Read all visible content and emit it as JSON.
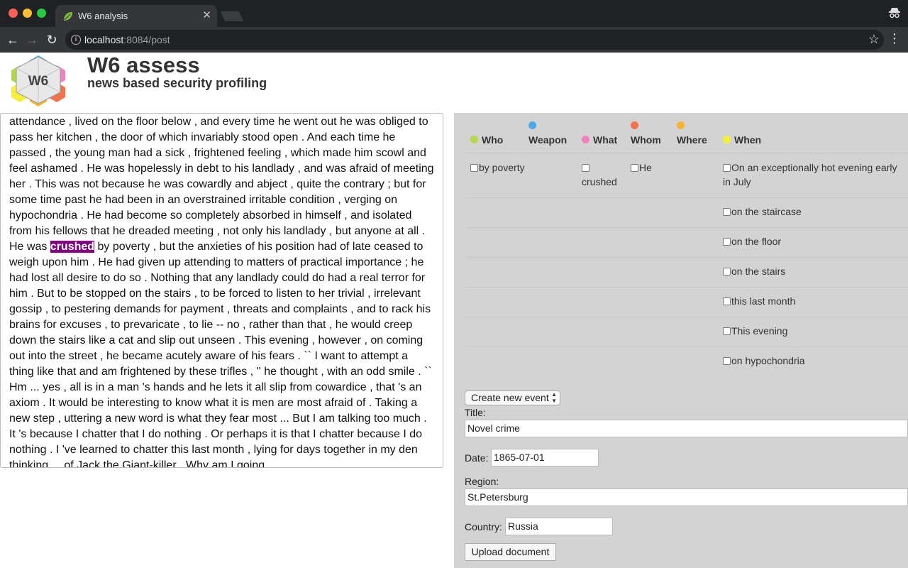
{
  "browser": {
    "tab_title": "W6 analysis",
    "tab_close": "✕",
    "url_host": "localhost",
    "url_rest": ":8084/post"
  },
  "header": {
    "logo_text": "W6",
    "title": "W6 assess",
    "subtitle": "news based security profiling"
  },
  "text_panel": {
    "before": "attendance , lived on the floor below , and every time he went out he was obliged to pass her kitchen , the door of which invariably stood open . And each time he passed , the young man had a sick , frightened feeling , which made him scowl and feel ashamed . He was hopelessly in debt to his landlady , and was afraid of meeting her . This was not because he was cowardly and abject , quite the contrary ; but for some time past he had been in an overstrained irritable condition , verging on hypochondria . He had become so completely absorbed in himself , and isolated from his fellows that he dreaded meeting , not only his landlady , but anyone at all . He was ",
    "highlight": "crushed",
    "after": " by poverty , but the anxieties of his position had of late ceased to weigh upon him . He had given up attending to matters of practical importance ; he had lost all desire to do so . Nothing that any landlady could do had a real terror for him . But to be stopped on the stairs , to be forced to listen to her trivial , irrelevant gossip , to pestering demands for payment , threats and complaints , and to rack his brains for excuses , to prevaricate , to lie -- no , rather than that , he would creep down the stairs like a cat and slip out unseen . This evening , however , on coming out into the street , he became acutely aware of his fears . `` I want to attempt a thing like that and am frightened by these trifles , '' he thought , with an odd smile . `` Hm ... yes , all is in a man 's hands and he lets it all slip from cowardice , that 's an axiom . It would be interesting to know what it is men are most afraid of . Taking a new step , uttering a new word is what they fear most ... But I am talking too much . It 's because I chatter that I do nothing . Or perhaps it is that I chatter because I do nothing . I 've learned to chatter this last month , lying for days together in my den thinking ... of Jack the Giant-killer . Why am I going"
  },
  "categories": {
    "who": {
      "label": "Who",
      "color": "#b3d94a"
    },
    "weapon": {
      "label": "Weapon",
      "color": "#4aa9e8"
    },
    "what": {
      "label": "What",
      "color": "#f082c0"
    },
    "whom": {
      "label": "Whom",
      "color": "#f4734f"
    },
    "where": {
      "label": "Where",
      "color": "#f7b52f"
    },
    "when": {
      "label": "When",
      "color": "#f5ef3a"
    }
  },
  "items": {
    "who": [
      "by poverty"
    ],
    "what": [
      "crushed"
    ],
    "whom": [
      "He"
    ],
    "when": [
      "On an exceptionally hot evening early in July",
      "on the staircase",
      "on the floor",
      "on the stairs",
      "this last month",
      "This evening",
      "on hypochondria"
    ]
  },
  "form": {
    "event_select": "Create new event",
    "title_label": "Title:",
    "title_value": "Novel crime",
    "date_label": "Date:",
    "date_value": "1865-07-01",
    "region_label": "Region:",
    "region_value": "St.Petersburg",
    "country_label": "Country:",
    "country_value": "Russia",
    "upload_label": "Upload document"
  }
}
